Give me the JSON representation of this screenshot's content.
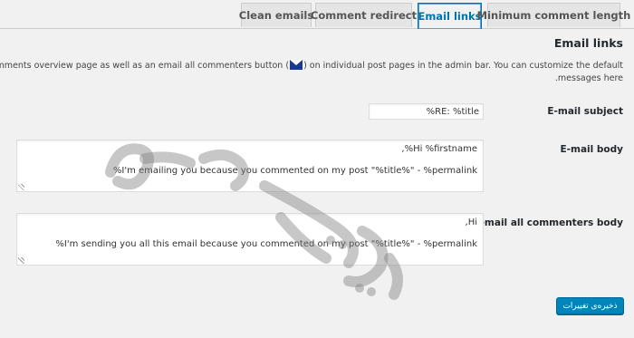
{
  "tabs": [
    {
      "label": "Clean emails"
    },
    {
      "label": "Comment redirect"
    },
    {
      "label": "Email links"
    },
    {
      "label": "Minimum comment length"
    }
  ],
  "section": {
    "title": "Email links",
    "description_line1_start": "mail\" action link on the comments overview page as well as an email all commenters button (",
    "description_line1_end": ") on individual post pages in the admin bar. You can customize the default",
    "description_line2": "messages here."
  },
  "fields": {
    "subject": {
      "label": "E-mail subject",
      "value": "RE: %title%"
    },
    "body": {
      "label": "E-mail body",
      "line1": "Hi %firstname%,",
      "line2": "I'm emailing you because you commented on my post \"%title%\" - %permalink%"
    },
    "all_commenters": {
      "label": "E-mail all commenters body",
      "line1": "Hi,",
      "line2": "I'm sending you all this email because you commented on my post \"%title%\" - %permalink%"
    }
  },
  "save_button": {
    "label": "ذخیره‌ی تغییرات"
  },
  "icons": {
    "mail": "mail-icon",
    "resize": "resize-grip-icon"
  },
  "colors": {
    "accent": "#0073aa",
    "button": "#0085ba",
    "background": "#f1f1f1"
  }
}
